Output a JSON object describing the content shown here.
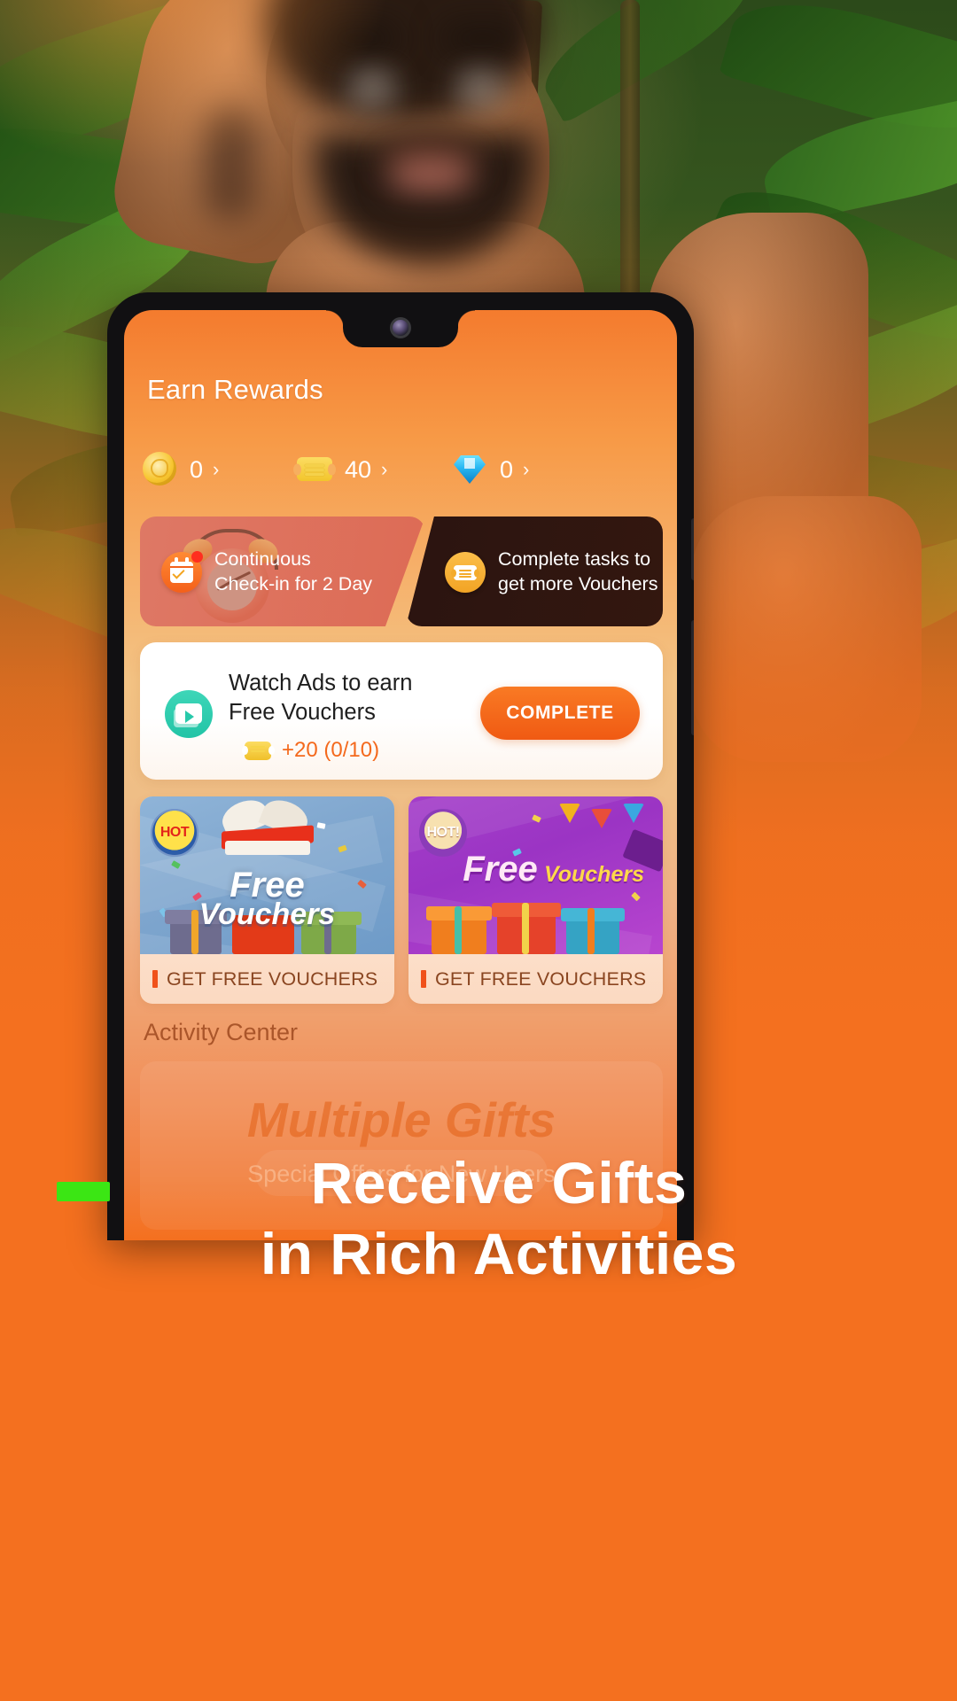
{
  "background": {
    "theme_color": "#F4701F",
    "scene": "man-in-jungle-photo"
  },
  "phone": {
    "app": {
      "page_title": "Earn Rewards",
      "currencies": [
        {
          "icon": "coin-icon",
          "value": "0",
          "chevron": "›"
        },
        {
          "icon": "ticket-icon",
          "value": "40",
          "chevron": "›"
        },
        {
          "icon": "gem-icon",
          "value": "0",
          "chevron": "›"
        }
      ],
      "banners": [
        {
          "icon": "calendar-check-icon",
          "line1": "Continuous",
          "line2": "Check-in for 2 Day",
          "bg": "#DD6B55"
        },
        {
          "icon": "voucher-ticket-icon",
          "line1": "Complete tasks to",
          "line2": "get more Vouchers",
          "bg": "#2B1410"
        }
      ],
      "task_card": {
        "icon": "video-play-icon",
        "title_line1": "Watch Ads  to earn",
        "title_line2": "Free Vouchers",
        "reward_icon": "ticket-icon",
        "reward_text": "+20 (0/10)",
        "reward_color": "#F4691D",
        "button_label": "COMPLETE",
        "button_color": "#F05A13"
      },
      "vouchers": [
        {
          "badge": "HOT",
          "art_title_line1": "Free",
          "art_title_line2": "Vouchers",
          "label": "GET FREE VOUCHERS",
          "theme": "blue"
        },
        {
          "badge": "HOT!",
          "art_title_line1": "Free",
          "art_title_line2": "Vouchers",
          "label": "GET FREE VOUCHERS",
          "theme": "purple"
        }
      ],
      "activity": {
        "section_title": "Activity Center",
        "banner_title": "Multiple Gifts",
        "banner_subtitle": "Special Offers for New Users"
      }
    }
  },
  "promo": {
    "accent_color": "#3BE614",
    "headline_line1": "Receive Gifts",
    "headline_line2": "in Rich Activities"
  }
}
